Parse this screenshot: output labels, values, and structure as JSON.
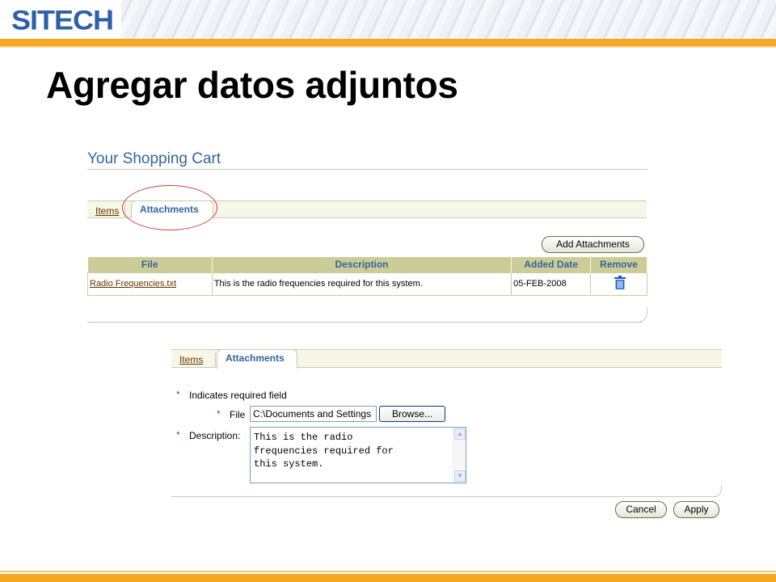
{
  "slide": {
    "logo_text": "SITECH",
    "logo_mark": "®",
    "title": "Agregar datos adjuntos"
  },
  "cart": {
    "title": "Your Shopping Cart",
    "tabs": [
      {
        "label": "Items",
        "active": false
      },
      {
        "label": "Attachments",
        "active": true
      }
    ],
    "add_button": "Add Attachments",
    "table": {
      "columns": [
        "File",
        "Description",
        "Added Date",
        "Remove"
      ],
      "rows": [
        {
          "file": "Radio Frequencies.txt",
          "description": "This is the radio frequencies required for this system.",
          "added_date": "05-FEB-2008",
          "remove_icon": "trash-icon"
        }
      ]
    }
  },
  "attach_form": {
    "tabs": [
      {
        "label": "Items",
        "active": false
      },
      {
        "label": "Attachments",
        "active": true
      }
    ],
    "required_note": "Indicates required field",
    "required_marker": "*",
    "file_label": "File",
    "file_value": "C:\\Documents and Settings",
    "browse_button": "Browse...",
    "description_label": "Description:",
    "description_value": "This is the radio\nfrequencies required for\nthis system.",
    "cancel_button": "Cancel",
    "apply_button": "Apply"
  },
  "colors": {
    "brand_blue": "#2f5fa8",
    "orange": "#f5a623",
    "header_tan": "#cccc99",
    "link_brown": "#663300",
    "title_blue": "#336699",
    "highlight_red": "#d93a3a"
  }
}
